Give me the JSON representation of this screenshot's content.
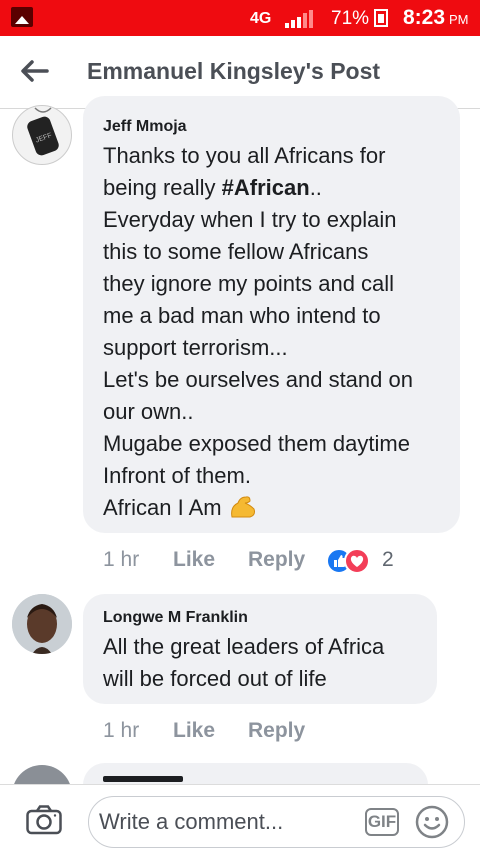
{
  "status_bar": {
    "network": "4G",
    "battery": "71%",
    "time": "8:23",
    "ampm": "PM"
  },
  "header": {
    "title": "Emmanuel Kingsley's Post"
  },
  "comments": [
    {
      "author": "Jeff Mmoja",
      "lines": [
        "Thanks to you all Africans for",
        "being really ",
        "#African",
        "..",
        "Everyday when I try to explain",
        "this to some fellow Africans",
        "they ignore my points and call",
        "me a bad man who intend to",
        "support terrorism...",
        "Let's be ourselves and stand on",
        "our own..",
        "Mugabe exposed them daytime",
        "Infront of them.",
        "African I Am"
      ],
      "time": "1 hr",
      "like": "Like",
      "reply": "Reply",
      "reactions_count": "2"
    },
    {
      "author": "Longwe M Franklin",
      "lines": [
        "All the great leaders of Africa",
        "will be forced out of life"
      ],
      "time": "1 hr",
      "like": "Like",
      "reply": "Reply"
    }
  ],
  "composer": {
    "placeholder": "Write a comment...",
    "gif": "GIF"
  }
}
